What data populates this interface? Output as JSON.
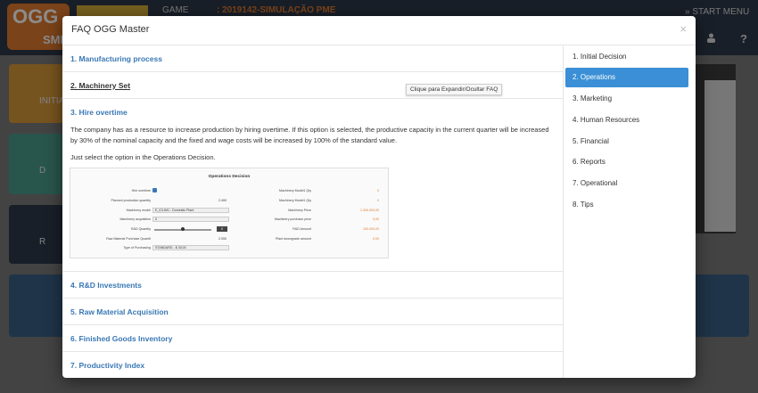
{
  "app": {
    "logo_text": "OGG",
    "logo_sub": "SME",
    "game_label": "GAME",
    "game_value": ": 2019142-SIMULAÇÃO PME",
    "start_menu": "» START MENU",
    "user_icon": "user-icon",
    "help_label": "?",
    "tiles": [
      {
        "label": "INITIA",
        "color": "#d89a3a"
      },
      {
        "label": "D",
        "color": "#4a9b8a"
      },
      {
        "label": "R",
        "color": "#2e3a4a"
      }
    ]
  },
  "modal": {
    "title": "FAQ OGG Master",
    "close_label": "×",
    "tooltip": "Clique para Expandir/Ocultar FAQ",
    "items": [
      {
        "label": "1. Manufacturing process"
      },
      {
        "label": "2. Machinery Set"
      },
      {
        "label": "3. Hire overtime"
      },
      {
        "label": "4. R&D Investments"
      },
      {
        "label": "5. Raw Material Acquisition"
      },
      {
        "label": "6. Finished Goods Inventory"
      },
      {
        "label": "7. Productivity Index"
      }
    ],
    "overtime_text": "The company has as a resource to increase production by hiring overtime. If this option is selected, the productive capacity in the current quarter will be increased by 30% of the nominal capacity and the fixed and wage costs will be increased by 100% of the standard value.",
    "overtime_hint": "Just select the option in the Operations Decision.",
    "screenshot": {
      "title": "Operations Decision",
      "left_rows": [
        {
          "label": "Hire overtime",
          "value": ""
        },
        {
          "label": "Planned production quantity",
          "value": "2.400"
        },
        {
          "label": "Machinery model",
          "value": "E_ICLIM1 - Domestic Plant"
        },
        {
          "label": "Machinery acquisition",
          "value": "0"
        },
        {
          "label": "R&D Quantity",
          "value": "0"
        },
        {
          "label": "Raw Material Purchase Quantit",
          "value": "2.000"
        },
        {
          "label": "Type of Purchasing",
          "value": "STANDARD - $ 30,00"
        }
      ],
      "right_rows": [
        {
          "label": "Machinery Model1 Qty",
          "value": "0"
        },
        {
          "label": "Machinery Model1 Qty",
          "value": "0"
        },
        {
          "label": "Machinery Price",
          "value": "1.300.000,00"
        },
        {
          "label": "Machinery purchase price",
          "value": "0,00"
        },
        {
          "label": "R&D Amount",
          "value": "100.000,00"
        },
        {
          "label": "Plant downgrade amount",
          "value": "0,00"
        }
      ]
    }
  },
  "menu": {
    "items": [
      {
        "label": "1. Initial Decision",
        "active": false
      },
      {
        "label": "2. Operations",
        "active": true
      },
      {
        "label": "3. Marketing",
        "active": false
      },
      {
        "label": "4. Human Resources",
        "active": false
      },
      {
        "label": "5. Financial",
        "active": false
      },
      {
        "label": "6. Reports",
        "active": false
      },
      {
        "label": "7. Operational",
        "active": false
      },
      {
        "label": "8. Tips",
        "active": false
      }
    ]
  },
  "colors": {
    "accent": "#3a8fd6",
    "link": "#3a78b4",
    "brand_orange": "#e07a2e"
  }
}
